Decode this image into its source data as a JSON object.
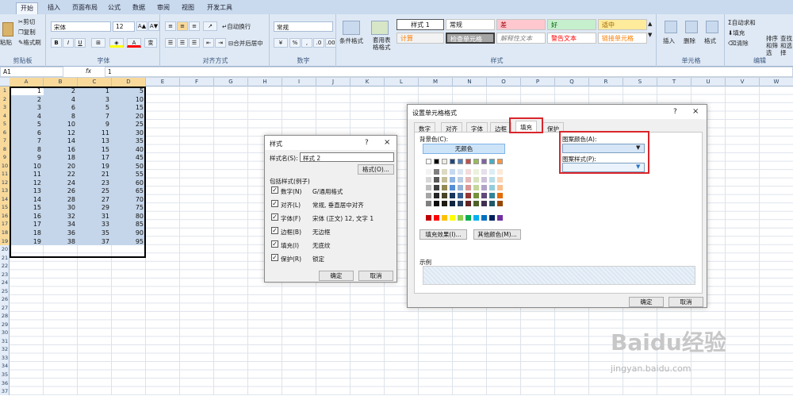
{
  "ribbon": {
    "tabs": [
      "开始",
      "插入",
      "页面布局",
      "公式",
      "数据",
      "审阅",
      "视图",
      "开发工具"
    ],
    "clipboard": {
      "paste": "粘贴",
      "cut": "剪切",
      "copy": "复制",
      "format_painter": "格式刷",
      "label": "剪贴板"
    },
    "font": {
      "name": "宋体",
      "size": "12",
      "label": "字体"
    },
    "alignment": {
      "wrap": "自动换行",
      "merge": "合并后居中",
      "label": "对齐方式"
    },
    "number": {
      "format": "常规",
      "label": "数字"
    },
    "styles": {
      "cond_format": "条件格式",
      "table_format": "套用表格格式",
      "cells": [
        "样式 1",
        "常规",
        "差",
        "好",
        "适中",
        "计算",
        "检查单元格",
        "解释性文本",
        "警告文本",
        "链接单元格"
      ],
      "label": "样式"
    },
    "cells_grp": {
      "insert": "插入",
      "delete": "删除",
      "format": "格式",
      "label": "单元格"
    },
    "editing": {
      "autosum": "自动求和",
      "fill": "填充",
      "clear": "清除",
      "sort": "排序和筛选",
      "find": "查找和选择",
      "label": "编辑"
    }
  },
  "formula_bar": {
    "name_box": "A1",
    "fx": "fx",
    "value": "1"
  },
  "columns": [
    "A",
    "B",
    "C",
    "D",
    "E",
    "F",
    "G",
    "H",
    "I",
    "J",
    "K",
    "L",
    "M",
    "N",
    "O",
    "P",
    "Q",
    "R",
    "S",
    "T",
    "U",
    "V",
    "W"
  ],
  "rows": [
    "1",
    "2",
    "3",
    "4",
    "5",
    "6",
    "7",
    "8",
    "9",
    "10",
    "11",
    "12",
    "13",
    "14",
    "15",
    "16",
    "17",
    "18",
    "19",
    "20",
    "21",
    "22",
    "23",
    "24",
    "25",
    "26",
    "27",
    "28",
    "29",
    "30",
    "31",
    "32",
    "33",
    "34",
    "35",
    "36",
    "37"
  ],
  "table": [
    [
      1,
      2,
      1,
      5
    ],
    [
      2,
      4,
      3,
      10
    ],
    [
      3,
      6,
      5,
      15
    ],
    [
      4,
      8,
      7,
      20
    ],
    [
      5,
      10,
      9,
      25
    ],
    [
      6,
      12,
      11,
      30
    ],
    [
      7,
      14,
      13,
      35
    ],
    [
      8,
      16,
      15,
      40
    ],
    [
      9,
      18,
      17,
      45
    ],
    [
      10,
      20,
      19,
      50
    ],
    [
      11,
      22,
      21,
      55
    ],
    [
      12,
      24,
      23,
      60
    ],
    [
      13,
      26,
      25,
      65
    ],
    [
      14,
      28,
      27,
      70
    ],
    [
      15,
      30,
      29,
      75
    ],
    [
      16,
      32,
      31,
      80
    ],
    [
      17,
      34,
      33,
      85
    ],
    [
      18,
      36,
      35,
      90
    ],
    [
      19,
      38,
      37,
      95
    ]
  ],
  "style_dialog": {
    "title": "样式",
    "help": "?",
    "close": "×",
    "style_name_label": "样式名(S):",
    "style_name_value": "样式 2",
    "format_btn": "格式(O)...",
    "includes_label": "包括样式(例子)",
    "items": [
      {
        "label": "数字(N)",
        "value": "G/通用格式"
      },
      {
        "label": "对齐(L)",
        "value": "常规, 垂直居中对齐"
      },
      {
        "label": "字体(F)",
        "value": "宋体 (正文) 12, 文字 1"
      },
      {
        "label": "边框(B)",
        "value": "无边框"
      },
      {
        "label": "填充(I)",
        "value": "无底纹"
      },
      {
        "label": "保护(R)",
        "value": "锁定"
      }
    ],
    "ok": "确定",
    "cancel": "取消"
  },
  "format_dialog": {
    "title": "设置单元格格式",
    "help": "?",
    "close": "×",
    "tabs": [
      "数字",
      "对齐",
      "字体",
      "边框",
      "填充",
      "保护"
    ],
    "active_tab": "填充",
    "bg_label": "背景色(C):",
    "no_color": "无颜色",
    "pattern_color_label": "图案颜色(A):",
    "pattern_style_label": "图案样式(P):",
    "fill_effects": "填充效果(I)...",
    "more_colors": "其他颜色(M)...",
    "sample_label": "示例",
    "ok": "确定",
    "cancel": "取消",
    "theme_top": [
      "#ffffff",
      "#000000",
      "#eeece1",
      "#1f497d",
      "#4f81bd",
      "#c0504d",
      "#9bbb59",
      "#8064a2",
      "#4bacc6",
      "#f79646"
    ],
    "theme_tints": [
      [
        "#f2f2f2",
        "#7f7f7f",
        "#ddd9c3",
        "#c6d9f0",
        "#dbe5f1",
        "#f2dcdb",
        "#ebf1dd",
        "#e5e0ec",
        "#dbeef3",
        "#fdeada"
      ],
      [
        "#d8d8d8",
        "#595959",
        "#c4bd97",
        "#8db3e2",
        "#b8cce4",
        "#e5b9b7",
        "#d7e3bc",
        "#ccc1d9",
        "#b7dde8",
        "#fbd5b5"
      ],
      [
        "#bfbfbf",
        "#3f3f3f",
        "#938953",
        "#548dd4",
        "#95b3d7",
        "#d99694",
        "#c3d69b",
        "#b2a2c7",
        "#92cddc",
        "#fac08f"
      ],
      [
        "#a5a5a5",
        "#262626",
        "#494429",
        "#17365d",
        "#366092",
        "#953734",
        "#76923c",
        "#5f497a",
        "#31859b",
        "#e36c09"
      ],
      [
        "#7f7f7f",
        "#0c0c0c",
        "#1d1b10",
        "#0f243e",
        "#244061",
        "#632423",
        "#4f6128",
        "#3f3151",
        "#205867",
        "#974806"
      ]
    ],
    "standard": [
      "#c00000",
      "#ff0000",
      "#ffc000",
      "#ffff00",
      "#92d050",
      "#00b050",
      "#00b0f0",
      "#0070c0",
      "#002060",
      "#7030a0"
    ]
  },
  "watermark": {
    "brand": "Baidu",
    "brand_cn": "经验",
    "url": "jingyan.baidu.com"
  },
  "colors": {
    "highlight": "#d9262b",
    "selected_header": "#f9d99a"
  }
}
